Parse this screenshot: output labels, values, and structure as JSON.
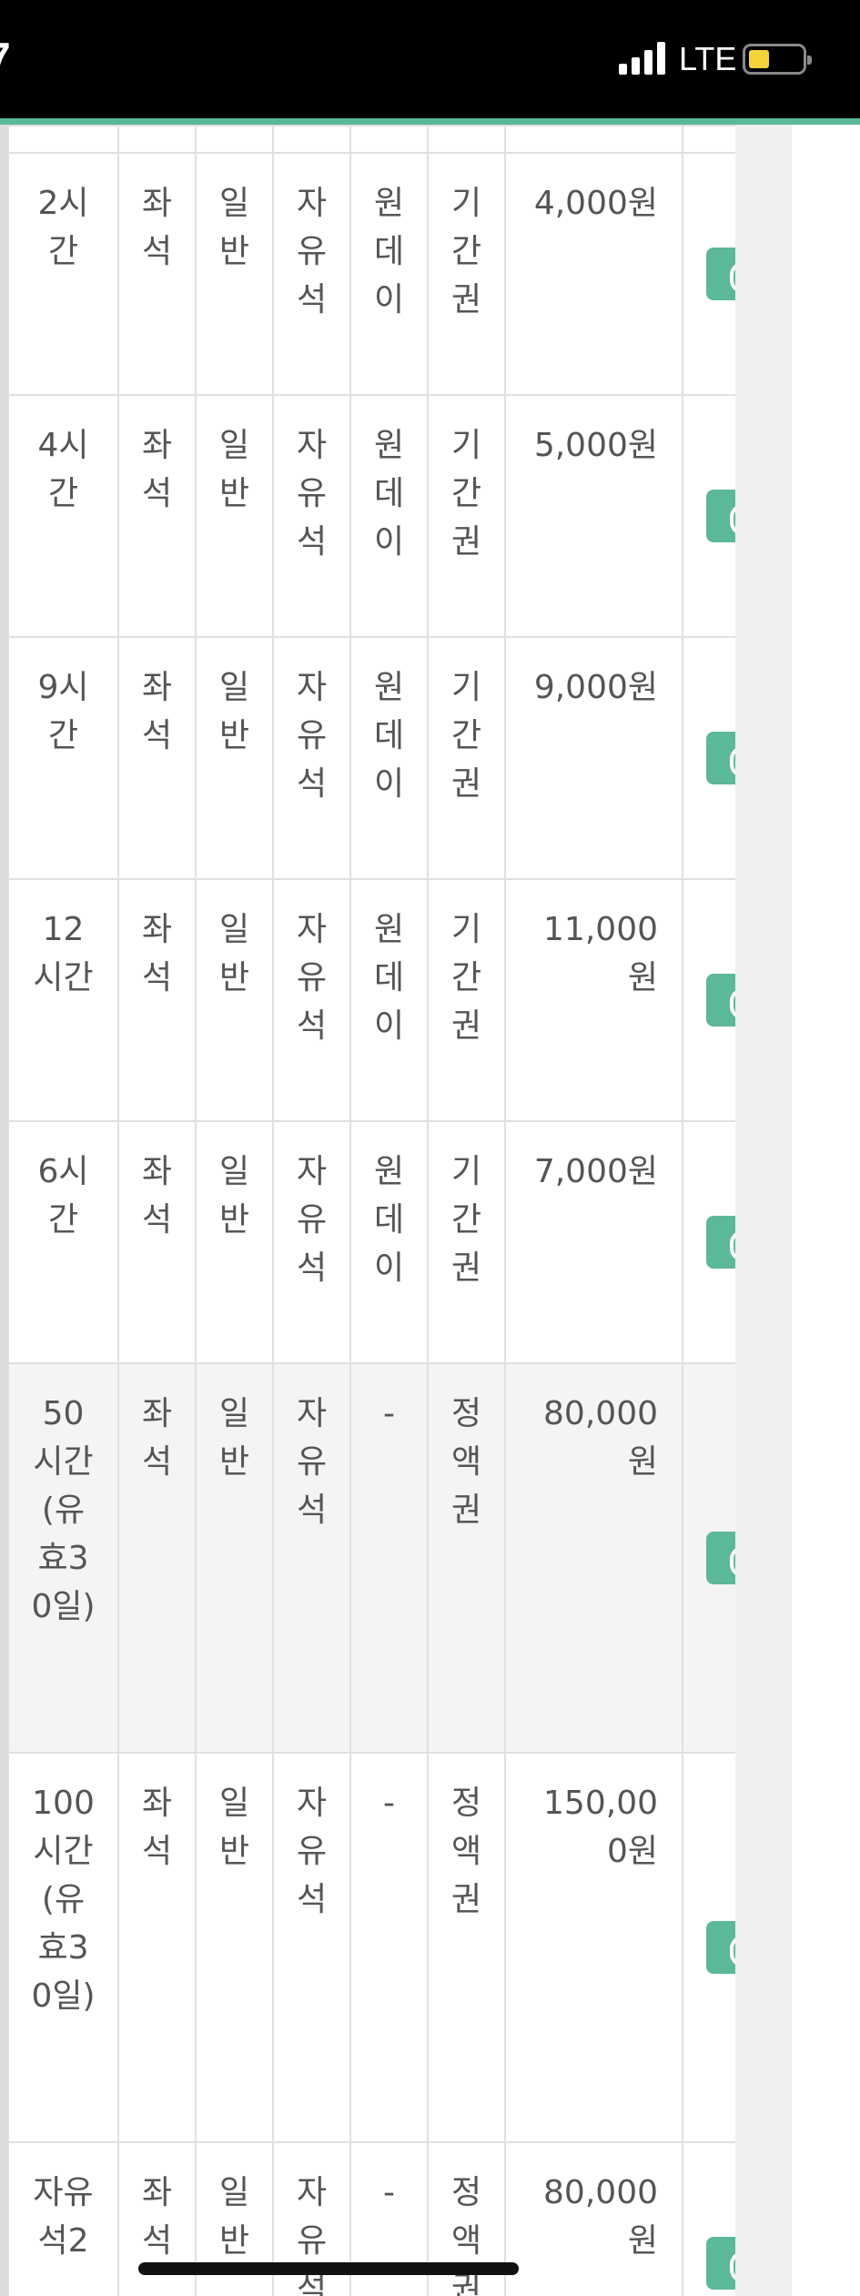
{
  "status_bar": {
    "time_fragment": "7",
    "network": "LTE",
    "signal_icon": "cellular-signal-icon",
    "battery_icon": "battery-low-icon",
    "battery_color": "#f5d33a"
  },
  "accent_color": "#5cb89a",
  "products": [
    {
      "name": "2시간",
      "category": "좌석",
      "member_type": "일반",
      "seat_type": "자유석",
      "usage": "원데이",
      "ticket_type": "기간권",
      "price": "4,000원",
      "shaded": false
    },
    {
      "name": "4시간",
      "category": "좌석",
      "member_type": "일반",
      "seat_type": "자유석",
      "usage": "원데이",
      "ticket_type": "기간권",
      "price": "5,000원",
      "shaded": false
    },
    {
      "name": "9시간",
      "category": "좌석",
      "member_type": "일반",
      "seat_type": "자유석",
      "usage": "원데이",
      "ticket_type": "기간권",
      "price": "9,000원",
      "shaded": false
    },
    {
      "name": "12시간",
      "category": "좌석",
      "member_type": "일반",
      "seat_type": "자유석",
      "usage": "원데이",
      "ticket_type": "기간권",
      "price": "11,000원",
      "shaded": false
    },
    {
      "name": "6시간",
      "category": "좌석",
      "member_type": "일반",
      "seat_type": "자유석",
      "usage": "원데이",
      "ticket_type": "기간권",
      "price": "7,000원",
      "shaded": false
    },
    {
      "name": "50시간(유효30일)",
      "category": "좌석",
      "member_type": "일반",
      "seat_type": "자유석",
      "usage": "-",
      "ticket_type": "정액권",
      "price": "80,000원",
      "shaded": true
    },
    {
      "name": "100시간(유효30일)",
      "category": "좌석",
      "member_type": "일반",
      "seat_type": "자유석",
      "usage": "-",
      "ticket_type": "정액권",
      "price": "150,000원",
      "shaded": false
    },
    {
      "name": "자유석2",
      "category": "좌석",
      "member_type": "일반",
      "seat_type": "자유석",
      "usage": "-",
      "ticket_type": "정액권",
      "price": "80,000원",
      "shaded": false
    }
  ]
}
